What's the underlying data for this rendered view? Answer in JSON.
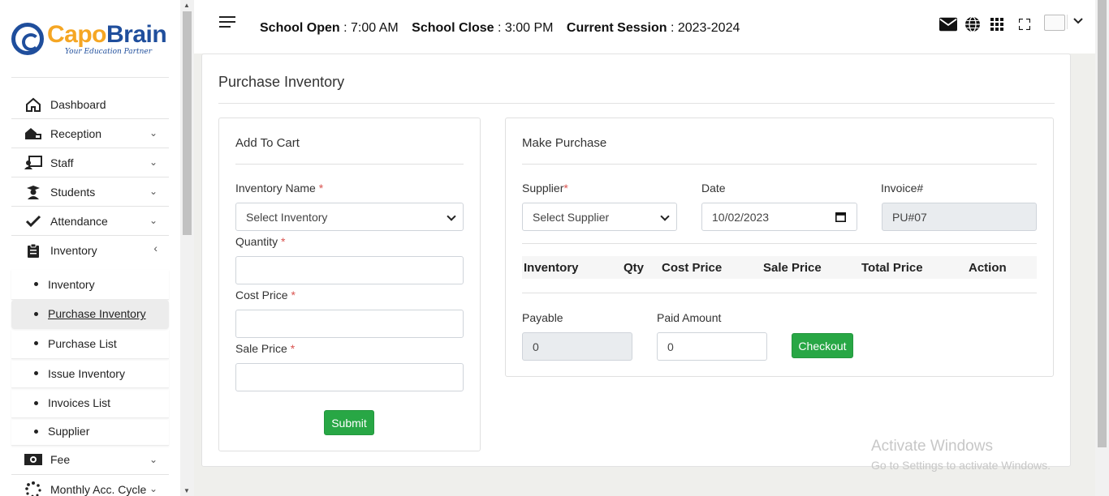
{
  "brand": {
    "name_part1": "Capo",
    "name_part2": "Brain",
    "tagline": "Your Education Partner"
  },
  "sidebar": {
    "items": [
      {
        "label": "Dashboard",
        "icon": "home-icon"
      },
      {
        "label": "Reception",
        "icon": "reception-icon"
      },
      {
        "label": "Staff",
        "icon": "staff-icon"
      },
      {
        "label": "Students",
        "icon": "graduate-icon"
      },
      {
        "label": "Attendance",
        "icon": "check-icon"
      },
      {
        "label": "Inventory",
        "icon": "clipboard-icon"
      }
    ],
    "sub_items": [
      "Inventory",
      "Purchase Inventory",
      "Purchase List",
      "Issue Inventory",
      "Invoices List",
      "Supplier"
    ],
    "bottom_items": [
      {
        "label": "Fee",
        "icon": "money-icon"
      },
      {
        "label": "Monthly Acc. Cycle",
        "icon": "spinner-icon"
      }
    ]
  },
  "topbar": {
    "school_open_label": "School Open",
    "school_open_value": ": 7:00 AM",
    "school_close_label": "School Close",
    "school_close_value": ": 3:00 PM",
    "session_label": "Current Session",
    "session_value": ": 2023-2024"
  },
  "page": {
    "title": "Purchase Inventory",
    "add_to_cart": {
      "title": "Add To Cart",
      "inventory_label": "Inventory Name",
      "inventory_selected": "Select Inventory",
      "quantity_label": "Quantity",
      "cost_label": "Cost Price",
      "sale_label": "Sale Price",
      "required_mark": "*",
      "submit_label": "Submit"
    },
    "make_purchase": {
      "title": "Make Purchase",
      "supplier_label": "Supplier",
      "supplier_selected": "Select Supplier",
      "date_label": "Date",
      "date_value": "10/02/2023",
      "invoice_label": "Invoice#",
      "invoice_value": "PU#07",
      "columns": [
        "Inventory",
        "Qty",
        "Cost Price",
        "Sale Price",
        "Total Price",
        "Action"
      ],
      "payable_label": "Payable",
      "payable_value": "0",
      "paid_label": "Paid Amount",
      "paid_value": "0",
      "checkout_label": "Checkout"
    }
  },
  "watermark": {
    "line1": "Activate Windows",
    "line2": "Go to Settings to activate Windows."
  },
  "colors": {
    "accent": "#28a745",
    "brand_orange": "#f5a623",
    "brand_blue": "#1f4e9c"
  }
}
